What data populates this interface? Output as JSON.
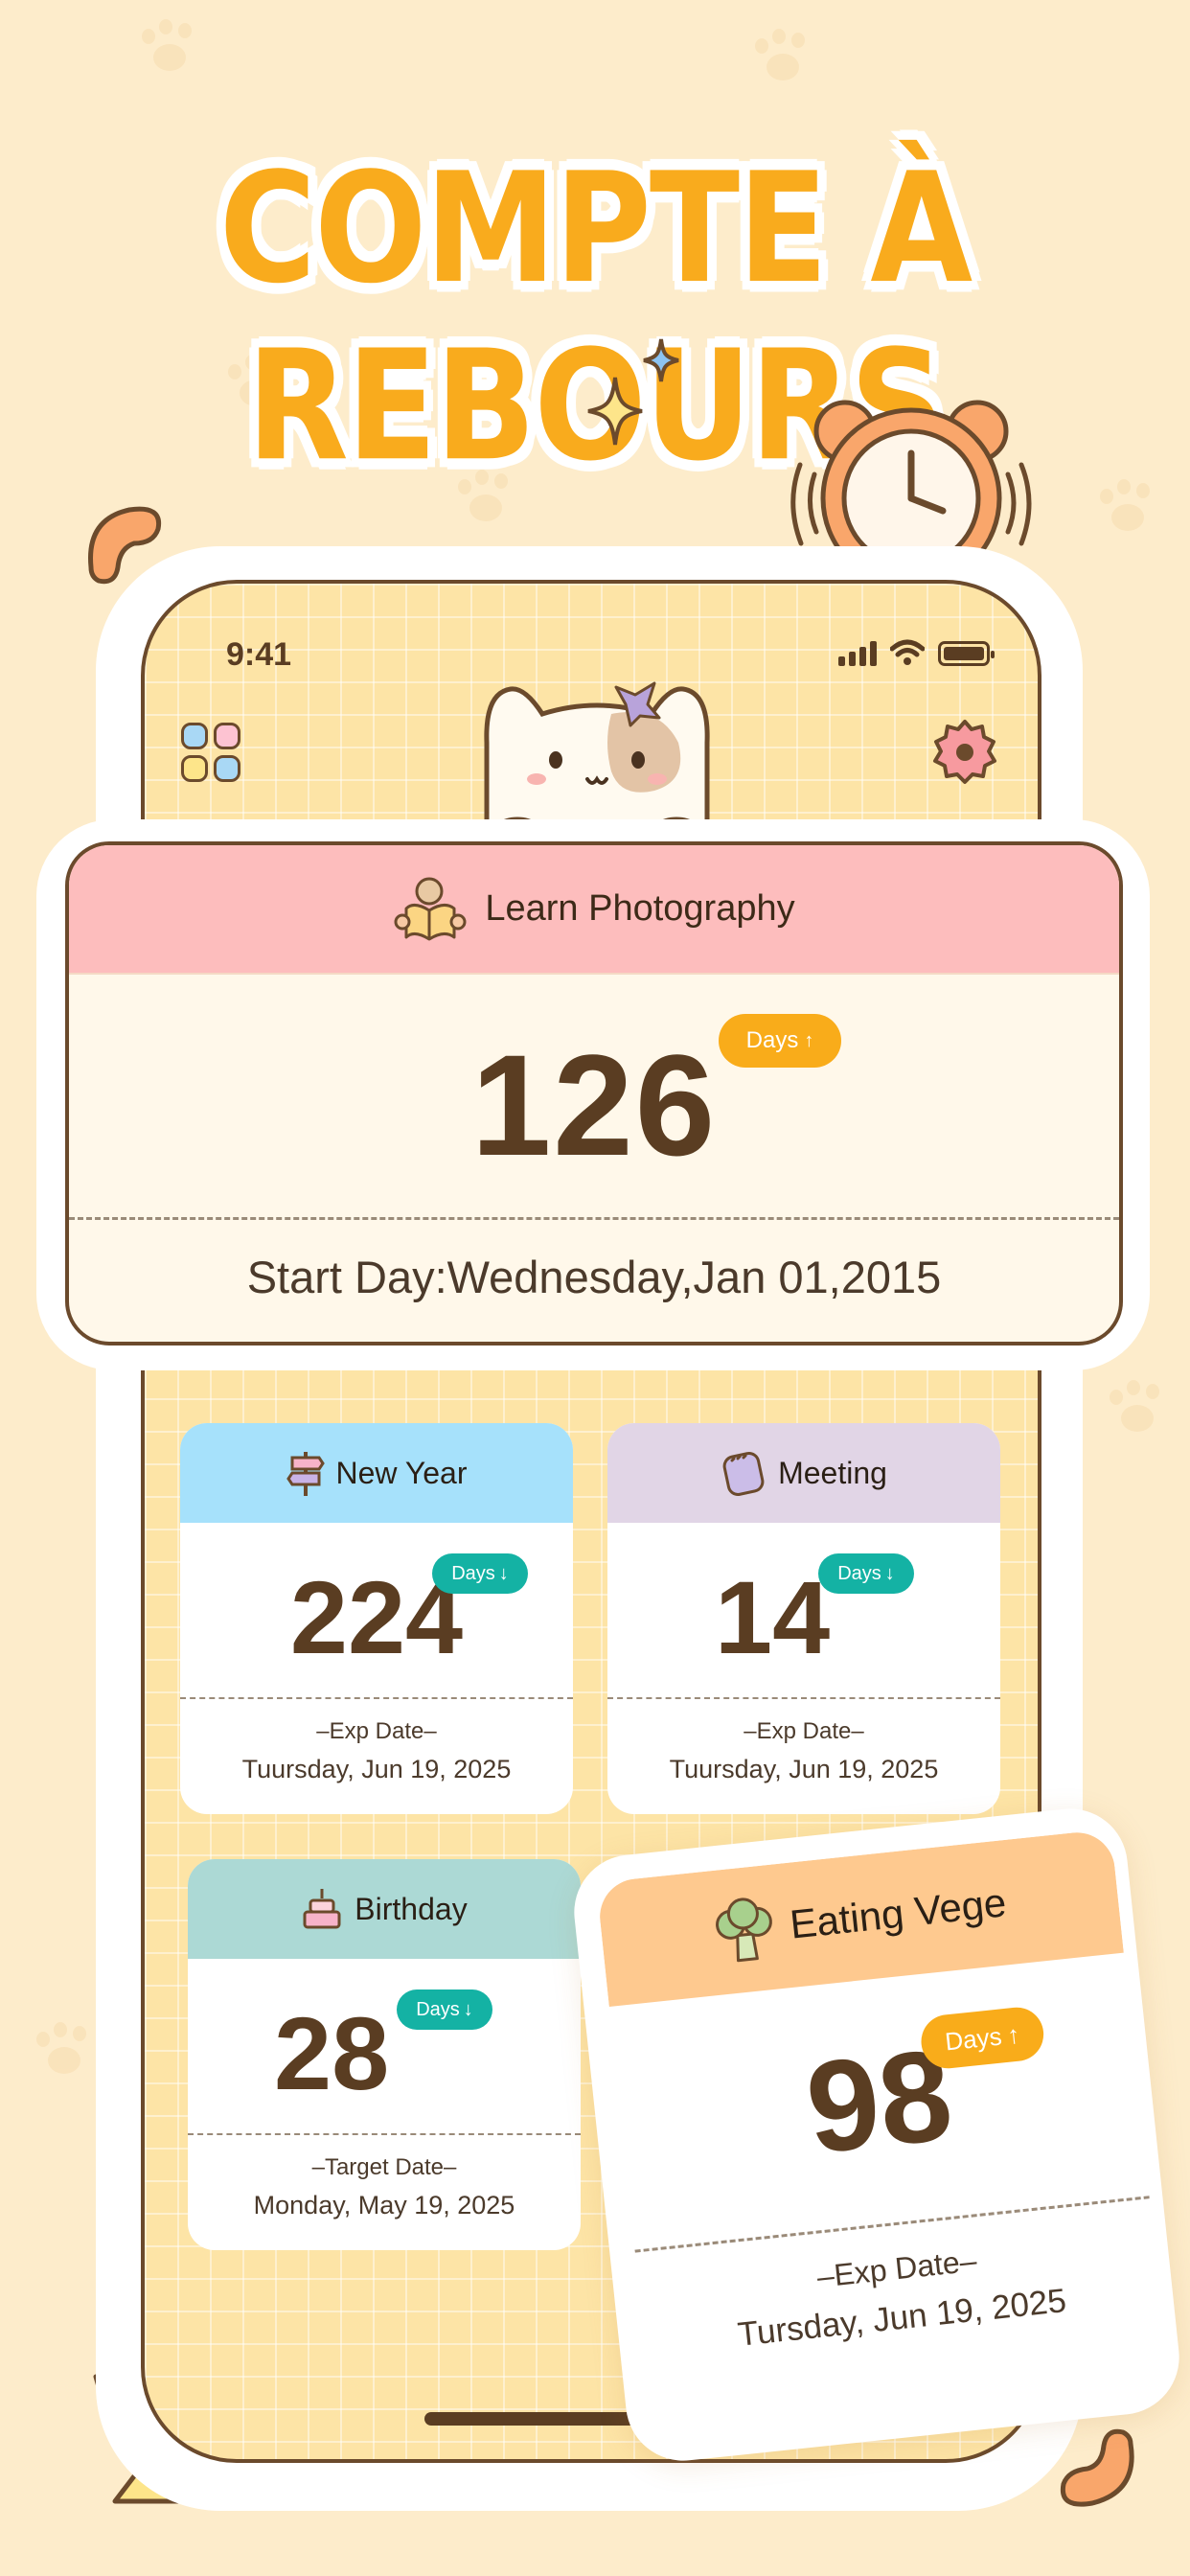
{
  "headline": "COMPTE À REBOURS",
  "status_bar": {
    "time": "9:41"
  },
  "colors": {
    "background": "#fdeccb",
    "accent_orange": "#f9ab1d",
    "teal_badge": "#14b2a4",
    "brown_text": "#5a3d22",
    "pink_header": "#fdbdbd",
    "blue_header": "#a6e1fb",
    "lavender_header": "#e1d5e6",
    "mint_header": "#acd9d5",
    "peach_header": "#fec98f"
  },
  "main_event": {
    "title": "Learn Photography",
    "icon": "reading-person-icon",
    "count": "126",
    "badge": "Days",
    "badge_arrow": "↑",
    "start_text": "Start Day:Wednesday,Jan 01,2015"
  },
  "events": [
    {
      "title": "New Year",
      "icon": "signpost-icon",
      "count": "224",
      "badge": "Days",
      "badge_arrow": "↓",
      "label": "–Exp Date–",
      "date": "Tuursday, Jun 19, 2025"
    },
    {
      "title": "Meeting",
      "icon": "notebook-icon",
      "count": "14",
      "badge": "Days",
      "badge_arrow": "↓",
      "label": "–Exp Date–",
      "date": "Tuursday, Jun 19, 2025"
    },
    {
      "title": "Birthday",
      "icon": "cake-icon",
      "count": "28",
      "badge": "Days",
      "badge_arrow": "↓",
      "label": "–Target Date–",
      "date": "Monday, May 19, 2025"
    },
    {
      "title": "Eating Vege",
      "icon": "broccoli-icon",
      "count": "98",
      "badge": "Days",
      "badge_arrow": "↑",
      "label": "–Exp Date–",
      "date": "Tursday, Jun 19, 2025"
    }
  ]
}
